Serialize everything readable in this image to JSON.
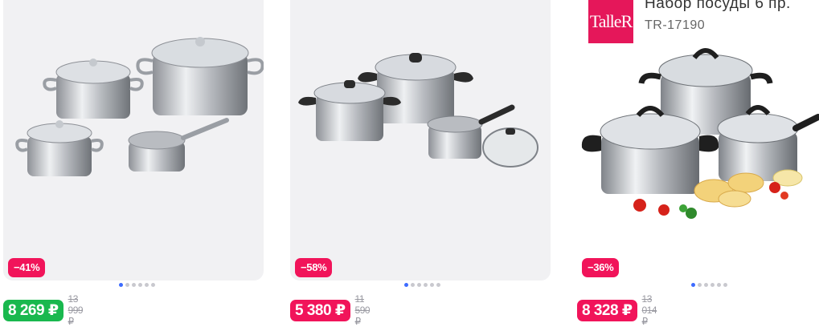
{
  "products": [
    {
      "discount": "−41%",
      "discount_color": "#f1145a",
      "price": "8 269 ₽",
      "price_color": "#19b84e",
      "old_price": "13 999 ₽",
      "image_icon": "cookware-set-image",
      "dots_total": 6,
      "dots_active": 1
    },
    {
      "discount": "−58%",
      "discount_color": "#f1145a",
      "price": "5 380 ₽",
      "price_color": "#f1145a",
      "old_price": "11 590 ₽",
      "image_icon": "cookware-set-image",
      "dots_total": 6,
      "dots_active": 1
    },
    {
      "discount": "−36%",
      "discount_color": "#f1145a",
      "price": "8 328 ₽",
      "price_color": "#f1145a",
      "old_price": "13 014 ₽",
      "image_icon": "cookware-set-image",
      "dots_total": 6,
      "dots_active": 1,
      "brand": "TalleR",
      "promo_title": "Набор посуды 6 пр.",
      "promo_sku": "TR-17190"
    }
  ]
}
